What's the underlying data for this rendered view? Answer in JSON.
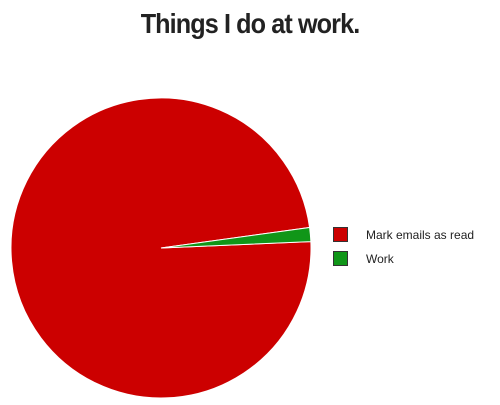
{
  "chart_data": {
    "type": "pie",
    "title": "Things I do at work.",
    "series": [
      {
        "name": "Mark emails as read",
        "value": 98.5,
        "color": "#cc0000"
      },
      {
        "name": "Work",
        "value": 1.5,
        "color": "#109618"
      }
    ],
    "legend_position": "right",
    "exploded_slice": "Work"
  }
}
